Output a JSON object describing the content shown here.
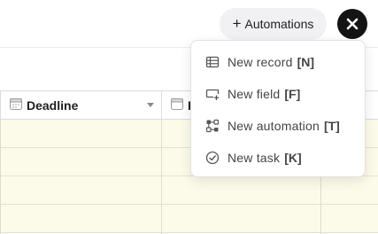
{
  "toolbar": {
    "automations_label": "Automations",
    "automations_plus": "+"
  },
  "grid": {
    "columns": [
      {
        "label": "Deadline",
        "icon": "calendar-icon"
      },
      {
        "label": "F",
        "icon": "calendar-icon"
      }
    ],
    "row_color": "#fcfbea"
  },
  "menu": {
    "items": [
      {
        "label": "New record",
        "shortcut": "[N]",
        "icon": "table-icon"
      },
      {
        "label": "New field",
        "shortcut": "[F]",
        "icon": "add-field-icon"
      },
      {
        "label": "New automation",
        "shortcut": "[T]",
        "icon": "automation-icon"
      },
      {
        "label": "New task",
        "shortcut": "[K]",
        "icon": "check-circle-icon"
      }
    ]
  }
}
